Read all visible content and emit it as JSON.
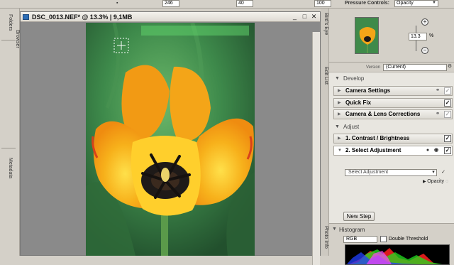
{
  "toolbar": {
    "field1_value": "246",
    "field2_value": "40",
    "field3_value": "100",
    "pressure_label": "Pressure Controls:",
    "pressure_value": "Opacity"
  },
  "left_dock": {
    "tabs": [
      "Folders",
      "Browser",
      "Metadata"
    ]
  },
  "document": {
    "title": "DSC_0013.NEF* @ 13.3% | 9,1MB",
    "minimize": "_",
    "maximize": "□",
    "close": "✕"
  },
  "right_dock": {
    "tabs": [
      "Bird's Eye",
      "Edit List",
      "Photo Info"
    ],
    "zoom_value": "13.3",
    "zoom_unit": "%"
  },
  "edit_list": {
    "version_label": "Version",
    "version_value": "(Current)",
    "develop_label": "Develop",
    "steps_develop": [
      {
        "label": "Camera Settings",
        "checked": false
      },
      {
        "label": "Quick Fix",
        "checked": true
      },
      {
        "label": "Camera & Lens Corrections",
        "checked": false
      }
    ],
    "adjust_label": "Adjust",
    "steps_adjust": [
      {
        "label": "1. Contrast / Brightness",
        "checked": true
      },
      {
        "label": "2. Select Adjustment",
        "checked": true
      }
    ],
    "select_adjustment_placeholder": "Select Adjustment",
    "opacity_label": "Opacity",
    "new_step_label": "New Step"
  },
  "histogram": {
    "title": "Histogram",
    "channel": "RGB",
    "double_threshold_label": "Double Threshold"
  },
  "colors": {
    "panel_bg": "#d4d0c8",
    "canvas_bg": "#8a8a8a",
    "petal_yellow": "#f6b21a",
    "petal_orange": "#f39a12",
    "leaf_green": "#3f8a4a"
  },
  "icons": [
    "document-icon",
    "zoom-in-icon",
    "zoom-out-icon",
    "panel-options-icon",
    "brush-cursor-icon",
    "link-icon"
  ]
}
